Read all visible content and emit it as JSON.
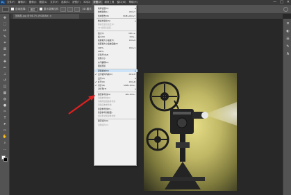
{
  "menubar": {
    "logo": "Ps",
    "items": [
      "文件(F)",
      "编辑(E)",
      "图像(I)",
      "图层(L)",
      "文字(Y)",
      "选择(S)",
      "滤镜(T)",
      "3D(D)",
      "视图(V)",
      "增效工具",
      "窗口(W)",
      "帮助(H)"
    ],
    "window_controls": [
      "—",
      "□",
      "✕"
    ]
  },
  "options_bar": {
    "auto_select": "自动选择:",
    "layer": "图层",
    "transform": "显示变换控件",
    "mode3d": "3D 模式:"
  },
  "document_tab": {
    "title": "放映机.jpg @ 66.7% (RGB/8#) ×"
  },
  "toolbar": {
    "tools": [
      "move-icon",
      "marquee-icon",
      "lasso-icon",
      "quick-select-icon",
      "crop-icon",
      "frame-icon",
      "eyedropper-icon",
      "healing-icon",
      "brush-icon",
      "stamp-icon",
      "history-brush-icon",
      "eraser-icon",
      "gradient-icon",
      "blur-icon",
      "dodge-icon",
      "pen-icon",
      "type-icon",
      "path-select-icon",
      "shape-icon",
      "hand-icon",
      "zoom-icon",
      "more-icon"
    ],
    "glyphs": [
      "✥",
      "⬚",
      "ᔕ",
      "✎",
      "⌗",
      "⊠",
      "✒",
      "✚",
      "✏",
      "⊥",
      "↺",
      "◫",
      "▦",
      "◍",
      "●",
      "✑",
      "T",
      "➤",
      "▭",
      "✋",
      "⌕",
      "…"
    ]
  },
  "dock": {
    "icons": [
      "≡",
      "◐",
      "☰",
      "✎",
      "A"
    ]
  },
  "view_menu": {
    "items": [
      {
        "label": "校样设置(U)",
        "shortcut": "",
        "submenu": true,
        "disabled": false
      },
      {
        "label": "校样颜色(L)",
        "shortcut": "Ctrl+Y",
        "submenu": false,
        "disabled": false
      },
      {
        "label": "色域警告(W)",
        "shortcut": "Shift+Ctrl+Y",
        "submenu": false,
        "disabled": false
      },
      {
        "label": "像素长宽比(S)",
        "shortcut": "",
        "submenu": true,
        "disabled": false
      },
      {
        "label": "像素长宽比校正(P)",
        "shortcut": "",
        "submenu": false,
        "disabled": true
      },
      {
        "label": "32 位预览选项...",
        "shortcut": "",
        "submenu": false,
        "disabled": true
      },
      {
        "label": "放大(I)",
        "shortcut": "Ctrl++",
        "submenu": false,
        "disabled": false
      },
      {
        "label": "缩小(O)",
        "shortcut": "Ctrl+-",
        "submenu": false,
        "disabled": false
      },
      {
        "label": "按屏幕大小缩放(F)",
        "shortcut": "Ctrl+0",
        "submenu": false,
        "disabled": false
      },
      {
        "label": "按屏幕大小缩放画板(F)",
        "shortcut": "",
        "submenu": false,
        "disabled": false
      },
      {
        "label": "100%",
        "shortcut": "Ctrl+1",
        "submenu": false,
        "disabled": false
      },
      {
        "label": "200%",
        "shortcut": "",
        "submenu": false,
        "disabled": false
      },
      {
        "label": "打印尺寸(Z)",
        "shortcut": "",
        "submenu": false,
        "disabled": false
      },
      {
        "label": "实际大小",
        "shortcut": "",
        "submenu": false,
        "disabled": false
      },
      {
        "label": "水平翻转(H)",
        "shortcut": "",
        "submenu": false,
        "disabled": false
      },
      {
        "label": "图案预览",
        "shortcut": "",
        "submenu": false,
        "disabled": false
      },
      {
        "label": "屏幕模式(M)",
        "shortcut": "",
        "submenu": true,
        "disabled": false
      },
      {
        "label": "显示额外内容(X)",
        "shortcut": "Ctrl+H",
        "submenu": false,
        "disabled": false,
        "checked": true
      },
      {
        "label": "显示(H)",
        "shortcut": "",
        "submenu": true,
        "disabled": false
      },
      {
        "label": "标尺(R)",
        "shortcut": "Ctrl+R",
        "submenu": false,
        "disabled": false,
        "checked": true
      },
      {
        "label": "对齐(N)",
        "shortcut": "Shift+Ctrl+;",
        "submenu": false,
        "disabled": false,
        "checked": true
      },
      {
        "label": "对齐到(T)",
        "shortcut": "",
        "submenu": true,
        "disabled": false
      },
      {
        "label": "锁定参考线(G)",
        "shortcut": "Alt+Ctrl+;",
        "submenu": false,
        "disabled": false
      },
      {
        "label": "清除参考线(D)",
        "shortcut": "",
        "submenu": false,
        "disabled": true
      },
      {
        "label": "清除所选画板参考线",
        "shortcut": "",
        "submenu": false,
        "disabled": true
      },
      {
        "label": "清除画布参考线",
        "shortcut": "",
        "submenu": false,
        "disabled": true
      },
      {
        "label": "新建参考线(E)...",
        "shortcut": "",
        "submenu": false,
        "disabled": false
      },
      {
        "label": "新建参考线版面...",
        "shortcut": "",
        "submenu": false,
        "disabled": false
      },
      {
        "label": "通过形状新建参考线",
        "shortcut": "",
        "submenu": false,
        "disabled": true
      },
      {
        "label": "锁定切片(K)",
        "shortcut": "",
        "submenu": false,
        "disabled": false
      },
      {
        "label": "清除切片(C)",
        "shortcut": "",
        "submenu": false,
        "disabled": true
      }
    ]
  },
  "colors": {
    "annotation_arrow": "#e02020",
    "highlight": "#cde3f7",
    "menu_bg": "#f0f0f0"
  }
}
